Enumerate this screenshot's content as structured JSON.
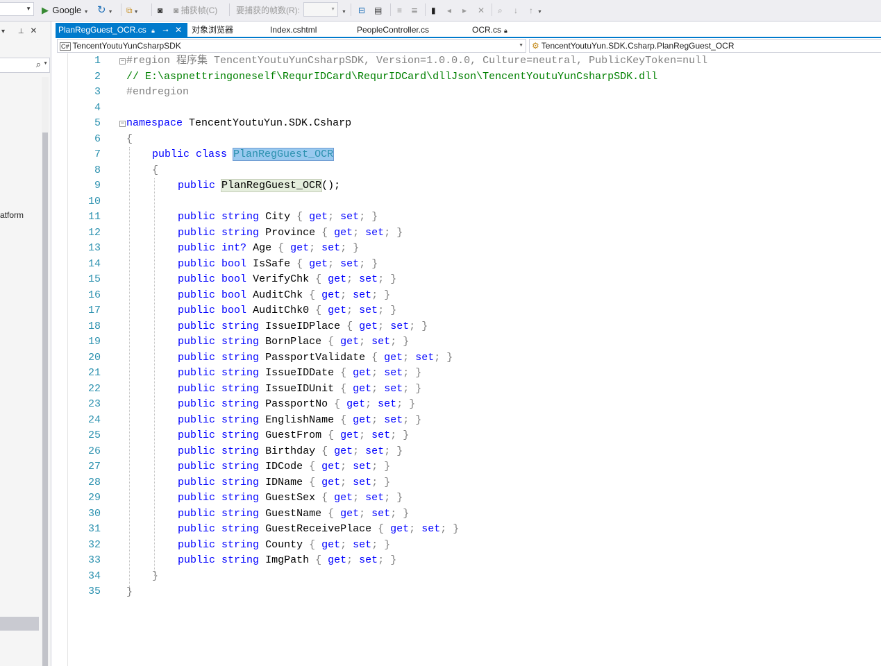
{
  "toolbar": {
    "browser_label": "Google",
    "capture_frame_label": "捕获帧(C)",
    "frames_to_capture_label": "要捕获的帧数(R):"
  },
  "left_panel": {
    "partial_text": "atform"
  },
  "tabs": [
    {
      "label": "PlanRegGuest_OCR.cs",
      "active": true
    },
    {
      "label": "对象浏览器",
      "active": false
    },
    {
      "label": "Index.cshtml",
      "active": false
    },
    {
      "label": "PeopleController.cs",
      "active": false
    },
    {
      "label": "OCR.cs",
      "active": false
    }
  ],
  "nav": {
    "project": "TencentYoutuYunCsharpSDK",
    "type": "TencentYoutuYun.SDK.Csharp.PlanRegGuest_OCR"
  },
  "code": {
    "region_line": "#region 程序集 TencentYoutuYunCsharpSDK, Version=1.0.0.0, Culture=neutral, PublicKeyToken=null",
    "path_comment": "// E:\\aspnettringoneself\\RequrIDCard\\RequrIDCard\\dllJson\\TencentYoutuYunCsharpSDK.dll",
    "endregion": "#endregion",
    "namespace_kw": "namespace",
    "namespace_name": "TencentYoutuYun.SDK.Csharp",
    "class_decl": "public class",
    "class_name": "PlanRegGuest_OCR",
    "ctor_kw": "public",
    "ctor_name": "PlanRegGuest_OCR",
    "ctor_tail": "();",
    "properties": [
      {
        "type": "string",
        "name": "City"
      },
      {
        "type": "string",
        "name": "Province"
      },
      {
        "type": "int?",
        "name": "Age"
      },
      {
        "type": "bool",
        "name": "IsSafe"
      },
      {
        "type": "bool",
        "name": "VerifyChk"
      },
      {
        "type": "bool",
        "name": "AuditChk"
      },
      {
        "type": "bool",
        "name": "AuditChk0"
      },
      {
        "type": "string",
        "name": "IssueIDPlace"
      },
      {
        "type": "string",
        "name": "BornPlace"
      },
      {
        "type": "string",
        "name": "PassportValidate"
      },
      {
        "type": "string",
        "name": "IssueIDDate"
      },
      {
        "type": "string",
        "name": "IssueIDUnit"
      },
      {
        "type": "string",
        "name": "PassportNo"
      },
      {
        "type": "string",
        "name": "EnglishName"
      },
      {
        "type": "string",
        "name": "GuestFrom"
      },
      {
        "type": "string",
        "name": "Birthday"
      },
      {
        "type": "string",
        "name": "IDCode"
      },
      {
        "type": "string",
        "name": "IDName"
      },
      {
        "type": "string",
        "name": "GuestSex"
      },
      {
        "type": "string",
        "name": "GuestName"
      },
      {
        "type": "string",
        "name": "GuestReceivePlace"
      },
      {
        "type": "string",
        "name": "County"
      },
      {
        "type": "string",
        "name": "ImgPath"
      }
    ],
    "line_numbers": [
      "1",
      "2",
      "3",
      "4",
      "5",
      "6",
      "7",
      "8",
      "9",
      "10",
      "11",
      "12",
      "13",
      "14",
      "15",
      "16",
      "17",
      "18",
      "19",
      "20",
      "21",
      "22",
      "23",
      "24",
      "25",
      "26",
      "27",
      "28",
      "29",
      "30",
      "31",
      "32",
      "33",
      "34",
      "35"
    ]
  }
}
